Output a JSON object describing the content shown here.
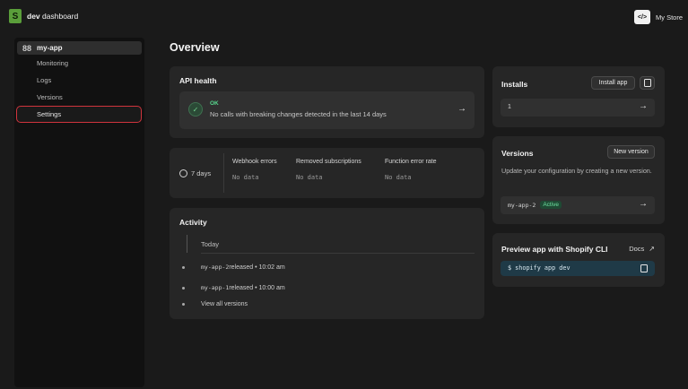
{
  "topbar": {
    "brand_bold": "dev",
    "brand_rest": "dashboard",
    "code_icon": "</>",
    "store_name": "My Store"
  },
  "sidebar": {
    "app_name": "my-app",
    "items": [
      {
        "label": "Monitoring"
      },
      {
        "label": "Logs"
      },
      {
        "label": "Versions"
      },
      {
        "label": "Settings"
      }
    ]
  },
  "main": {
    "title": "Overview",
    "api_health": {
      "title": "API health",
      "status": "OK",
      "message": "No calls with breaking changes detected in the last 14 days"
    },
    "stats": {
      "period": "7 days",
      "columns": [
        {
          "label": "Webhook errors",
          "value": "No data"
        },
        {
          "label": "Removed subscriptions",
          "value": "No data"
        },
        {
          "label": "Function error rate",
          "value": "No data"
        }
      ]
    },
    "activity": {
      "title": "Activity",
      "today_label": "Today",
      "events": [
        {
          "mono": "my-app-2",
          "text": " released • 10:02 am"
        },
        {
          "mono": "my-app-1",
          "text": " released • 10:00 am"
        },
        {
          "mono": "",
          "text": "View all versions"
        }
      ]
    }
  },
  "right": {
    "installs": {
      "title": "Installs",
      "button": "Install app",
      "count": "1"
    },
    "versions": {
      "title": "Versions",
      "button": "New version",
      "description": "Update your configuration by creating a new version.",
      "current": "my-app-2",
      "badge": "Active"
    },
    "preview": {
      "title": "Preview app with Shopify CLI",
      "docs": "Docs",
      "command": "$ shopify app dev"
    }
  },
  "colors": {
    "selected_outline": "#d0343d",
    "ok_green": "#58d68d",
    "cli_bg": "#1f3a47",
    "badge_bg": "#1f4a34"
  }
}
